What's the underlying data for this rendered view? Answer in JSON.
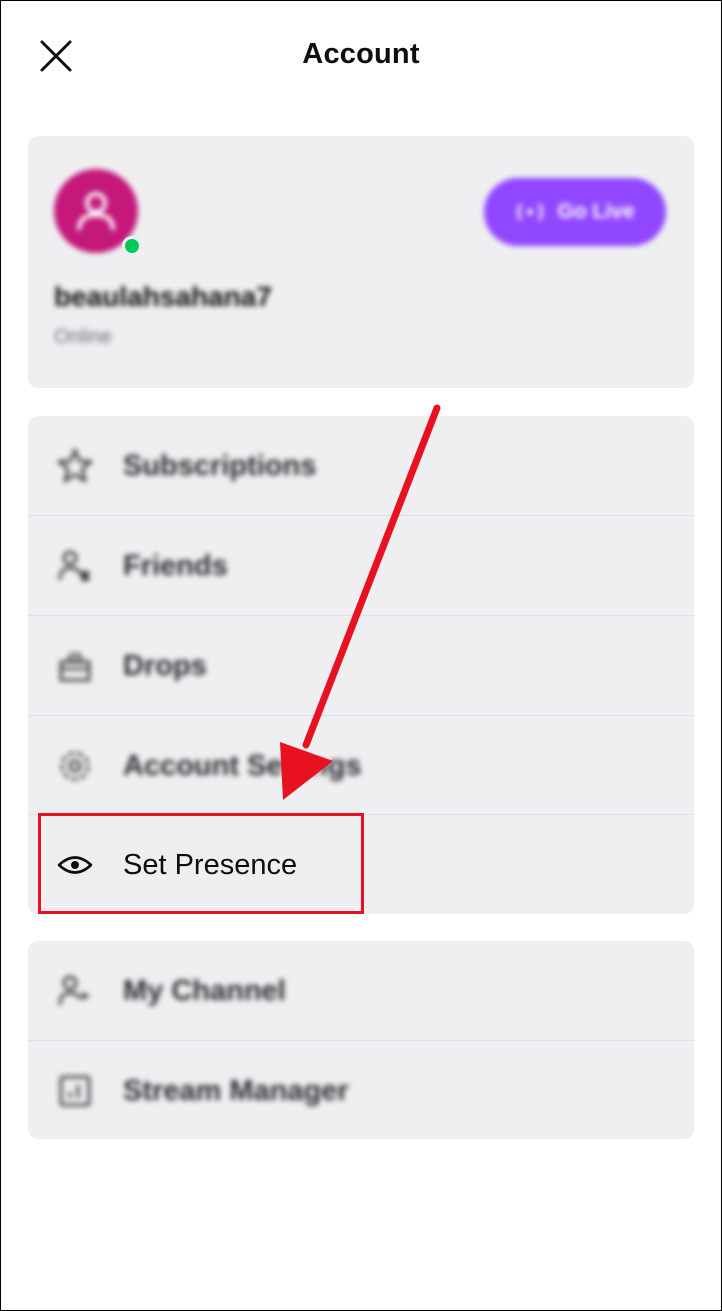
{
  "header": {
    "title": "Account",
    "close_icon": "close-icon"
  },
  "profile": {
    "username": "beaulahsahana7",
    "status": "Online",
    "go_live_label": "Go Live",
    "avatar_color": "#c4187a",
    "online_color": "#00c85a",
    "go_live_color": "#9147ff"
  },
  "menu": {
    "items": [
      {
        "label": "Subscriptions",
        "icon": "star-icon"
      },
      {
        "label": "Friends",
        "icon": "friends-icon"
      },
      {
        "label": "Drops",
        "icon": "gift-icon"
      },
      {
        "label": "Account Settings",
        "icon": "gear-icon"
      },
      {
        "label": "Set Presence",
        "icon": "eye-icon"
      }
    ]
  },
  "channel": {
    "items": [
      {
        "label": "My Channel",
        "icon": "channel-icon"
      },
      {
        "label": "Stream Manager",
        "icon": "stream-manager-icon"
      }
    ]
  },
  "annotation": {
    "color": "#e8111f"
  }
}
